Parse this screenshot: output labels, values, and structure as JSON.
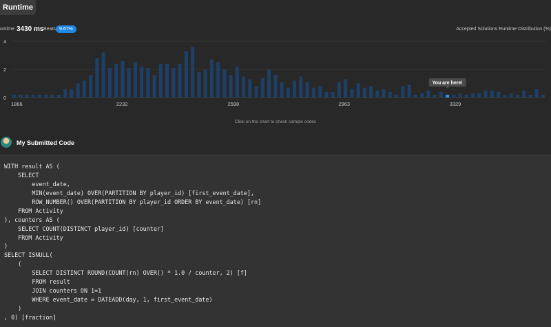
{
  "tab": {
    "label": "Runtime"
  },
  "runtime": {
    "label": "untime",
    "value": "3430 ms",
    "beats_label": "Beats",
    "beats_value": "9.67%",
    "distribution_label": "Accepted Solutions Runtime Distribution (%)"
  },
  "chart_data": {
    "type": "bar",
    "title": "",
    "xlabel": "",
    "ylabel": "",
    "ylim": [
      0,
      4
    ],
    "yticks": [
      "0",
      "2",
      "4"
    ],
    "xticks": [
      "1866",
      "2232",
      "2598",
      "2963",
      "3329"
    ],
    "grid": true,
    "values": [
      0.2,
      0.2,
      0.2,
      0.2,
      0.2,
      0.2,
      0.2,
      0.2,
      0.6,
      0.6,
      1.0,
      1.2,
      1.6,
      2.8,
      3.2,
      2.1,
      2.4,
      2.6,
      2.1,
      2.5,
      2.2,
      2.1,
      1.6,
      2.4,
      2.4,
      2.1,
      2.4,
      3.3,
      3.6,
      1.8,
      2.0,
      2.7,
      2.5,
      2.0,
      1.6,
      2.2,
      1.5,
      1.3,
      0.8,
      1.4,
      2.0,
      1.6,
      1.1,
      0.7,
      1.2,
      1.5,
      1.1,
      0.7,
      0.8,
      0.4,
      0.4,
      1.1,
      1.3,
      0.6,
      1.0,
      0.7,
      0.8,
      0.5,
      0.6,
      0.4,
      0.2,
      0.8,
      0.9,
      0.2,
      0.3,
      0.5,
      0.2,
      0.4,
      0.2,
      0.2,
      0.3,
      0.2,
      0.3,
      0.3,
      0.5,
      0.5,
      0.4,
      0.2,
      0.3,
      0.2,
      0.5,
      0.2,
      0.6,
      0.2
    ],
    "highlight_index": 68,
    "annotation": "You are here!",
    "bar_color": "#1e3f66",
    "highlight_color": "#2196f3",
    "hint": "Click on the chart to check sample codes"
  },
  "submission": {
    "title": "My Submitted Code",
    "avatar": "avatar-image",
    "code_lines": [
      "WITH result AS (",
      "    SELECT",
      "        event_date,",
      "        MIN(event_date) OVER(PARTITION BY player_id) [first_event_date],",
      "        ROW_NUMBER() OVER(PARTITION BY player_id ORDER BY event_date) [rn]",
      "    FROM Activity",
      "), counters AS (",
      "    SELECT COUNT(DISTINCT player_id) [counter]",
      "    FROM Activity",
      ")",
      "SELECT ISNULL(",
      "    (",
      "        SELECT DISTINCT ROUND(COUNT(rn) OVER() * 1.0 / counter, 2) [f]",
      "        FROM result",
      "        JOIN counters ON 1=1",
      "        WHERE event_date = DATEADD(day, 1, first_event_date)",
      "    )",
      ", 0) [fraction]"
    ]
  }
}
